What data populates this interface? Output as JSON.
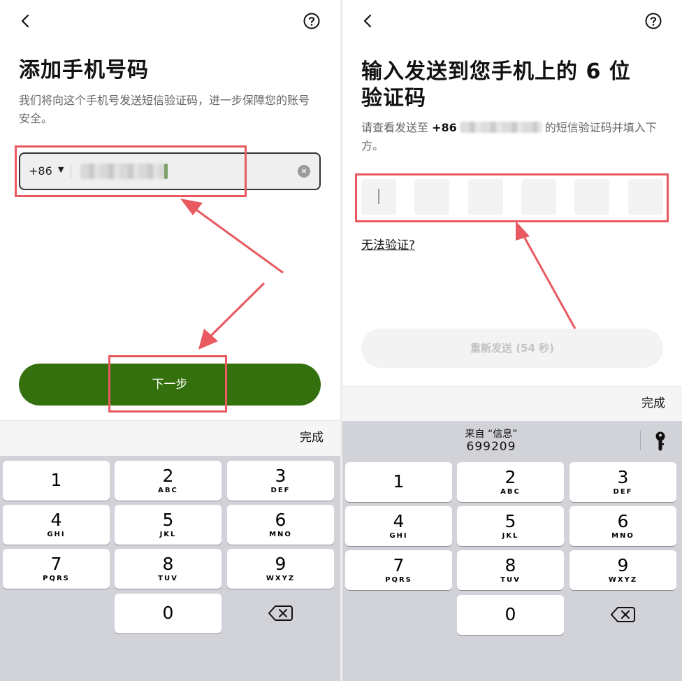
{
  "left_screen": {
    "title": "添加手机号码",
    "subtitle": "我们将向这个手机号发送短信验证码，进一步保障您的账号安全。",
    "country_code": "+86",
    "next_button": "下一步",
    "keyboard_done": "完成"
  },
  "right_screen": {
    "title_line1": "输入发送到您手机上的 6 位",
    "title_line2": "验证码",
    "subtitle_prefix": "请查看发送至",
    "subtitle_code": "+86",
    "subtitle_suffix": "的短信验证码并填入下方。",
    "cant_verify": "无法验证?",
    "resend_button": "重新发送 (54 秒)",
    "keyboard_done": "完成",
    "suggestion_label": "来自 “信息”",
    "suggestion_code": "699209"
  },
  "keypad": [
    {
      "digit": "1",
      "letters": ""
    },
    {
      "digit": "2",
      "letters": "ABC"
    },
    {
      "digit": "3",
      "letters": "DEF"
    },
    {
      "digit": "4",
      "letters": "GHI"
    },
    {
      "digit": "5",
      "letters": "JKL"
    },
    {
      "digit": "6",
      "letters": "MNO"
    },
    {
      "digit": "7",
      "letters": "PQRS"
    },
    {
      "digit": "8",
      "letters": "TUV"
    },
    {
      "digit": "9",
      "letters": "WXYZ"
    },
    {
      "digit": "0",
      "letters": ""
    }
  ],
  "colors": {
    "primary_green": "#35700e",
    "highlight_red": "#e85a5f",
    "keyboard_bg": "#d1d3d9"
  },
  "icons": {
    "back": "chevron-left-icon",
    "help": "question-circle-icon",
    "clear": "clear-circle-icon",
    "dropdown": "caret-down-icon",
    "delete": "backspace-icon",
    "password_key": "key-icon"
  }
}
